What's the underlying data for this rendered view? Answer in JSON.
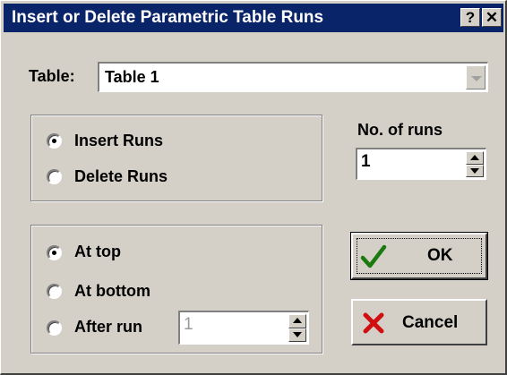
{
  "dialog": {
    "title": "Insert or Delete Parametric Table Runs",
    "help_label": "?",
    "close_label": "✕"
  },
  "table": {
    "label": "Table:",
    "value": "Table 1"
  },
  "mode_group": {
    "options": [
      {
        "label": "Insert Runs",
        "selected": true
      },
      {
        "label": "Delete Runs",
        "selected": false
      }
    ]
  },
  "runs": {
    "label": "No. of runs",
    "value": "1"
  },
  "position_group": {
    "options": [
      {
        "label": "At top",
        "selected": true
      },
      {
        "label": "At bottom",
        "selected": false
      },
      {
        "label": "After run",
        "selected": false
      }
    ],
    "after_run_value": "1"
  },
  "buttons": {
    "ok_label": "OK",
    "cancel_label": "Cancel",
    "ok_icon": "check-icon",
    "cancel_icon": "x-icon"
  },
  "colors": {
    "titlebar": "#0a246a",
    "face": "#d4d0c8",
    "check": "#1a7a10",
    "cancel_x": "#d01010"
  }
}
